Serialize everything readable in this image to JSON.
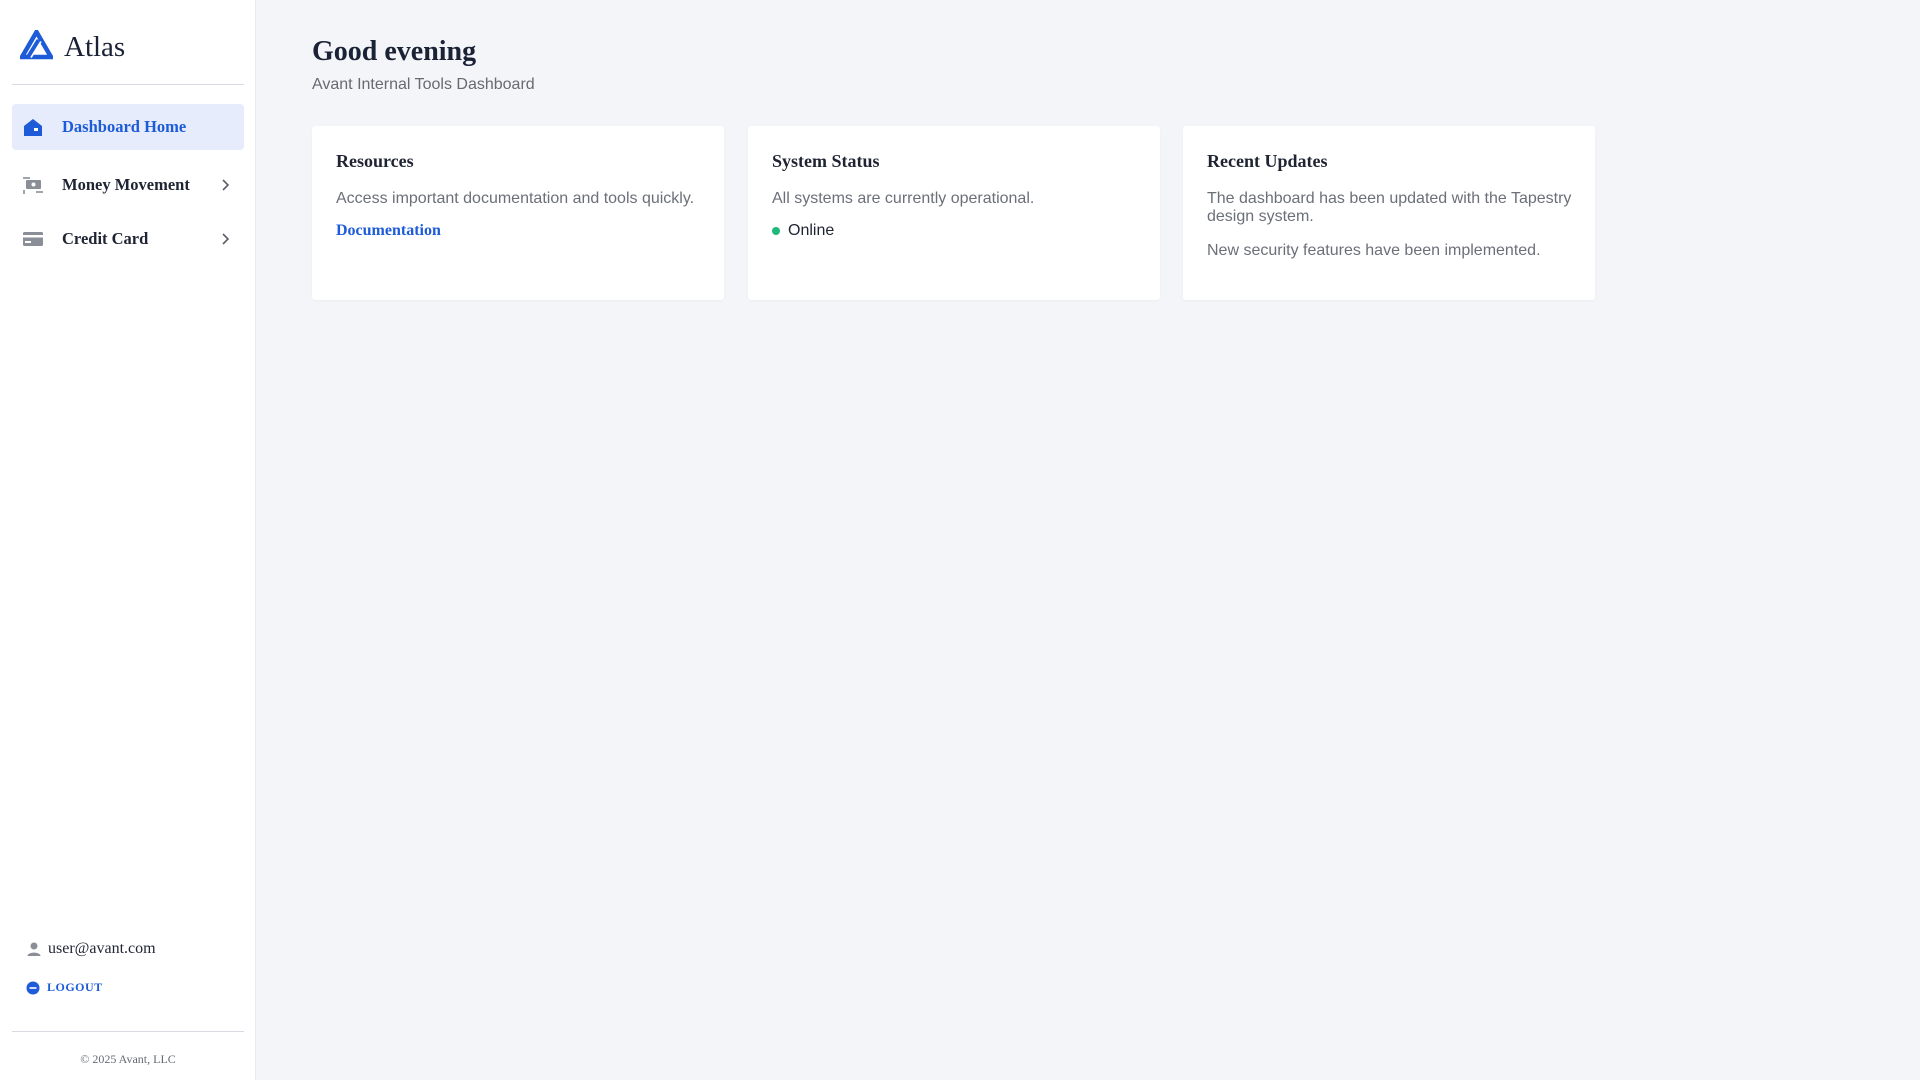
{
  "brand": {
    "name": "Atlas",
    "accent": "#1d5bd8"
  },
  "sidebar": {
    "items": [
      {
        "label": "Dashboard Home",
        "icon": "home-icon",
        "active": true
      },
      {
        "label": "Money Movement",
        "icon": "money-transfer-icon",
        "expandable": true
      },
      {
        "label": "Credit Card",
        "icon": "credit-card-icon",
        "expandable": true
      }
    ],
    "user_email": "user@avant.com",
    "logout_label": "LOGOUT",
    "copyright": "© 2025 Avant, LLC"
  },
  "header": {
    "title": "Good evening",
    "subtitle": "Avant Internal Tools Dashboard"
  },
  "cards": {
    "resources": {
      "title": "Resources",
      "text": "Access important documentation and tools quickly.",
      "link_label": "Documentation"
    },
    "system_status": {
      "title": "System Status",
      "text": "All systems are currently operational.",
      "status_label": "Online",
      "status_color": "#1fba7a"
    },
    "recent_updates": {
      "title": "Recent Updates",
      "updates": [
        "The dashboard has been updated with the Tapestry design system.",
        "New security features have been implemented."
      ]
    }
  }
}
